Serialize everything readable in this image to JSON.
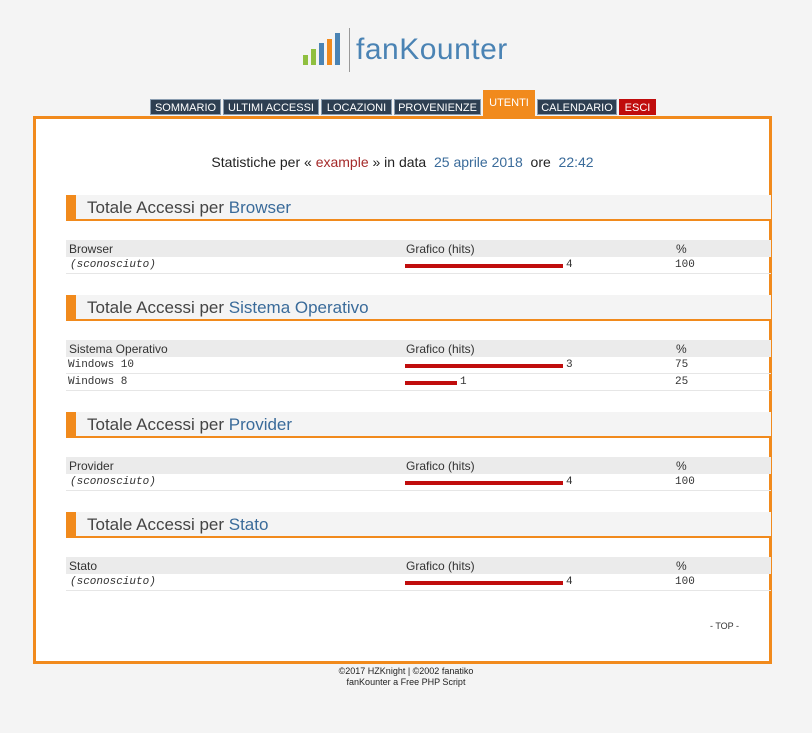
{
  "logo": {
    "text": "fanKounter"
  },
  "nav": {
    "tabs": [
      {
        "label": "SOMMARIO"
      },
      {
        "label": "ULTIMI ACCESSI"
      },
      {
        "label": "LOCAZIONI"
      },
      {
        "label": "PROVENIENZE"
      },
      {
        "label": "UTENTI"
      },
      {
        "label": "CALENDARIO"
      },
      {
        "label": "ESCI"
      }
    ]
  },
  "header": {
    "prefix": "Statistiche per «",
    "user": "example",
    "mid": "» in data",
    "date": "25 aprile 2018",
    "ore": "ore",
    "time": "22:42"
  },
  "sections": [
    {
      "title_prefix": "Totale Accessi per",
      "title_key": "Browser",
      "col1": "Browser",
      "col2": "Grafico (hits)",
      "col3": "%",
      "rows": [
        {
          "name": "(sconosciuto)",
          "hits": "4",
          "pct": "100",
          "fraction": 1.0
        }
      ]
    },
    {
      "title_prefix": "Totale Accessi per",
      "title_key": "Sistema Operativo",
      "col1": "Sistema Operativo",
      "col2": "Grafico (hits)",
      "col3": "%",
      "rows": [
        {
          "name": "Windows 10",
          "hits": "3",
          "pct": "75",
          "fraction": 1.0
        },
        {
          "name": "Windows 8",
          "hits": "1",
          "pct": "25",
          "fraction": 0.33
        }
      ]
    },
    {
      "title_prefix": "Totale Accessi per",
      "title_key": "Provider",
      "col1": "Provider",
      "col2": "Grafico (hits)",
      "col3": "%",
      "rows": [
        {
          "name": "(sconosciuto)",
          "hits": "4",
          "pct": "100",
          "fraction": 1.0
        }
      ]
    },
    {
      "title_prefix": "Totale Accessi per",
      "title_key": "Stato",
      "col1": "Stato",
      "col2": "Grafico (hits)",
      "col3": "%",
      "rows": [
        {
          "name": "(sconosciuto)",
          "hits": "4",
          "pct": "100",
          "fraction": 1.0
        }
      ]
    }
  ],
  "top_link": "- TOP -",
  "footer": {
    "line1": "©2017 HZKnight | ©2002 fanatiko",
    "line2": "fanKounter a Free PHP Script"
  },
  "colors": {
    "accent": "#f18a1c",
    "nav": "#2e3f52",
    "bar": "#c00d0d",
    "exit": "#c00d0d",
    "link": "#3a6b9a"
  }
}
